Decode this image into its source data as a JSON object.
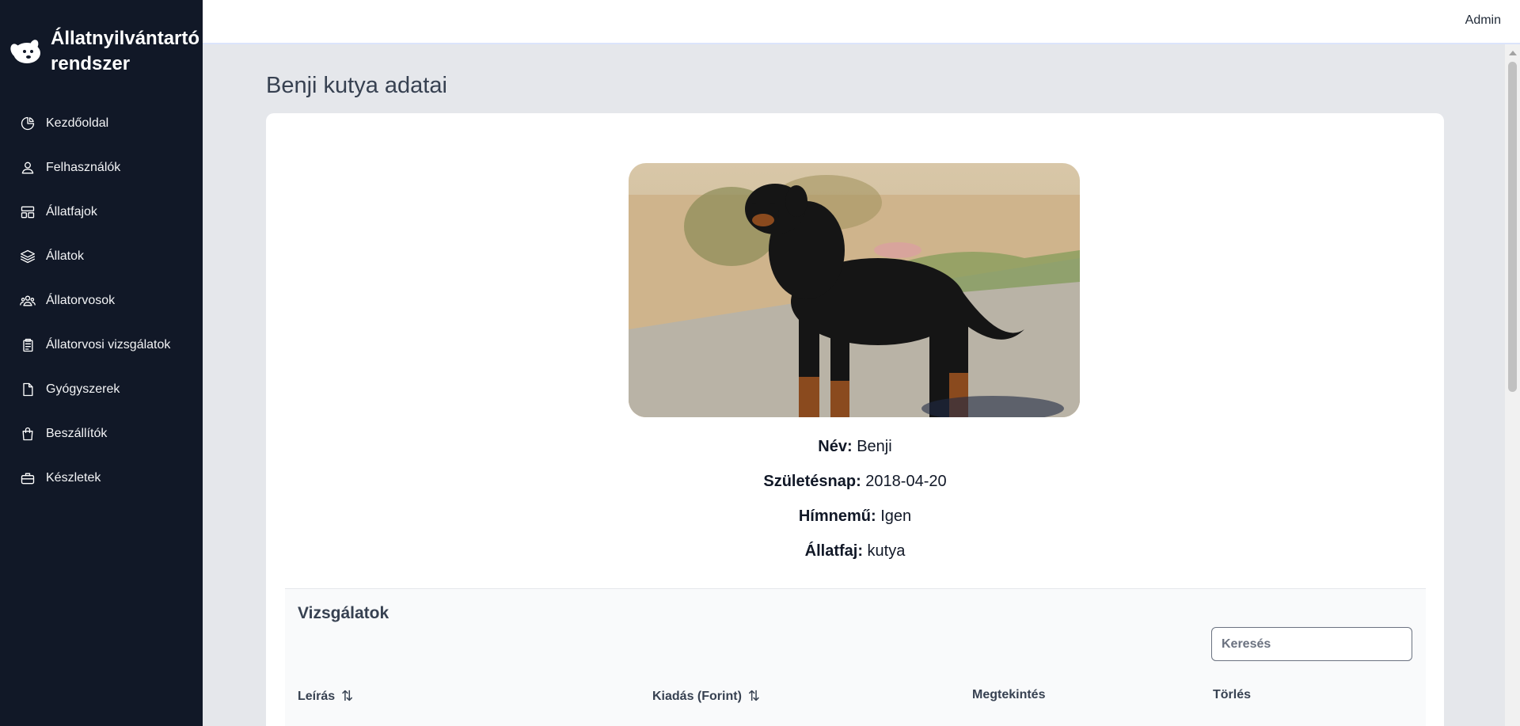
{
  "brand": {
    "title_line1": "Állatnyilvántartó",
    "title_line2": "rendszer"
  },
  "sidebar": {
    "items": [
      {
        "label": "Kezdőoldal",
        "icon": "pie-chart-icon"
      },
      {
        "label": "Felhasználók",
        "icon": "user-icon"
      },
      {
        "label": "Állatfajok",
        "icon": "layout-icon"
      },
      {
        "label": "Állatok",
        "icon": "layers-icon"
      },
      {
        "label": "Állatorvosok",
        "icon": "users-icon"
      },
      {
        "label": "Állatorvosi vizsgálatok",
        "icon": "clipboard-icon"
      },
      {
        "label": "Gyógyszerek",
        "icon": "file-icon"
      },
      {
        "label": "Beszállítók",
        "icon": "shopping-bag-icon"
      },
      {
        "label": "Készletek",
        "icon": "briefcase-icon"
      }
    ]
  },
  "topbar": {
    "user": "Admin"
  },
  "page": {
    "title": "Benji kutya adatai"
  },
  "animal": {
    "name_label": "Név:",
    "name": "Benji",
    "birth_label": "Születésnap:",
    "birth": "2018-04-20",
    "male_label": "Hímnemű:",
    "male": "Igen",
    "species_label": "Állatfaj:",
    "species": "kutya"
  },
  "exams": {
    "title": "Vizsgálatok",
    "search_placeholder": "Keresés",
    "columns": [
      "Leírás",
      "Kiadás (Forint)",
      "Megtekintés",
      "Törlés"
    ]
  },
  "colors": {
    "sidebar_bg": "#111827",
    "page_bg": "#e5e7eb",
    "card_bg": "#ffffff"
  }
}
